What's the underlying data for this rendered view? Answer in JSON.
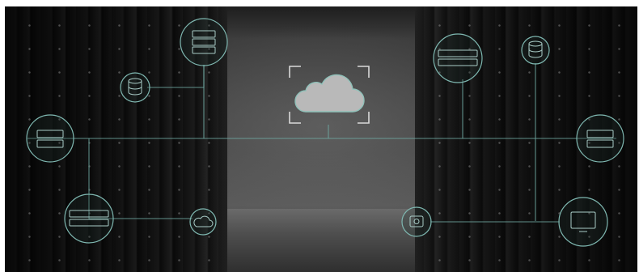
{
  "image": {
    "subject": "data-center-cloud-network",
    "accent_color": "#7fb8b1",
    "cloud_color": "#b9b9b9",
    "icons": [
      "cloud-icon",
      "database-icon",
      "server-icon",
      "monitor-icon"
    ]
  }
}
